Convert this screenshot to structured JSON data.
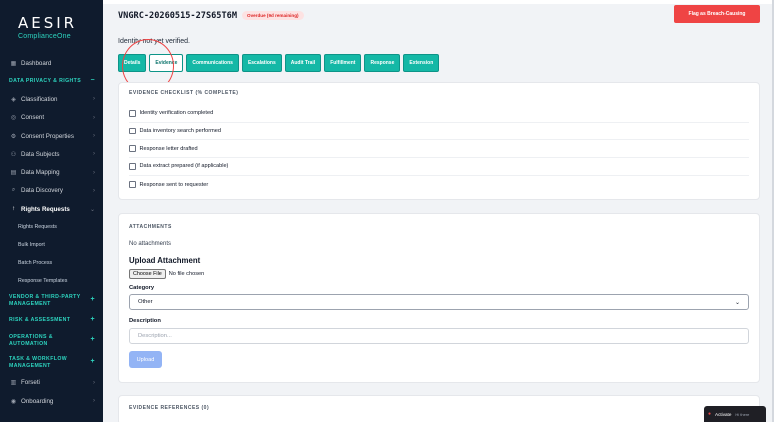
{
  "brand": {
    "name": "AESIR",
    "subtitle": "ComplianceOne"
  },
  "sidebar": {
    "items": [
      {
        "label": "Dashboard",
        "icon": "dashboard-icon"
      },
      {
        "section": "DATA PRIVACY & RIGHTS",
        "marker": "−"
      },
      {
        "label": "Classification",
        "icon": "tag-icon"
      },
      {
        "label": "Consent",
        "icon": "check-circle-icon"
      },
      {
        "label": "Consent Properties",
        "icon": "settings-icon"
      },
      {
        "label": "Data Subjects",
        "icon": "users-icon"
      },
      {
        "label": "Data Mapping",
        "icon": "map-icon"
      },
      {
        "label": "Data Discovery",
        "icon": "search-icon"
      },
      {
        "label": "Rights Requests",
        "icon": "arrow-up-icon",
        "active": true
      },
      {
        "sub": "Rights Requests"
      },
      {
        "sub": "Bulk Import"
      },
      {
        "sub": "Batch Process"
      },
      {
        "sub": "Response Templates"
      },
      {
        "section": "VENDOR & THIRD-PARTY MANAGEMENT",
        "marker": "+"
      },
      {
        "section": "RISK & ASSESSMENT",
        "marker": "+"
      },
      {
        "section": "OPERATIONS & AUTOMATION",
        "marker": "+"
      },
      {
        "section": "TASK & WORKFLOW MANAGEMENT",
        "marker": "+"
      },
      {
        "label": "Forseti",
        "icon": "book-icon"
      },
      {
        "label": "Onboarding",
        "icon": "compass-icon"
      }
    ]
  },
  "header": {
    "request_id": "VNGRC-20260515-27S65T6M",
    "badge": "Overdue (9d remaining)",
    "breach_button": "Flag as Breach-Causing"
  },
  "identity_status": "Identity not yet verified.",
  "tabs": [
    "Details",
    "Evidence",
    "Communications",
    "Escalations",
    "Audit Trail",
    "Fulfillment",
    "Response",
    "Extension"
  ],
  "active_tab": "Evidence",
  "checklist": {
    "title": "EVIDENCE CHECKLIST (% COMPLETE)",
    "items": [
      "Identity verification completed",
      "Data inventory search performed",
      "Response letter drafted",
      "Data extract prepared (if applicable)",
      "Response sent to requester"
    ]
  },
  "attachments": {
    "title": "ATTACHMENTS",
    "empty_text": "No attachments",
    "upload_title": "Upload Attachment",
    "file_button": "Choose File",
    "file_status": "No file chosen",
    "category_label": "Category",
    "category_value": "Other",
    "description_label": "Description",
    "description_placeholder": "Description...",
    "upload_button": "Upload"
  },
  "references": {
    "title": "EVIDENCE REFERENCES (0)"
  },
  "overlay": {
    "activate": "Activate",
    "extra": "Hi there"
  },
  "colors": {
    "sidebar_bg": "#0f1b2d",
    "accent": "#14b8a6",
    "danger": "#ef4444",
    "upload": "#93b4f5"
  }
}
